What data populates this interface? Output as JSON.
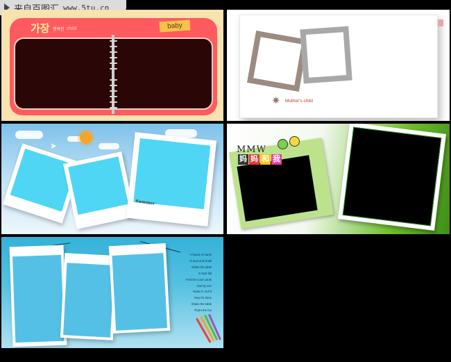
{
  "watermark": {
    "brand": "来自百图汇",
    "site": "www.5tu.cn",
    "arrow_icon": "play-triangle-icon"
  },
  "tiles": [
    {
      "id": "korean-notebook",
      "title_ko": "가장",
      "title_sub": "행복한",
      "title_en": "child",
      "tag": "baby",
      "colors": {
        "background": "#f7e2b0",
        "frame": "#ff5a5f",
        "inner": "#2a0606"
      }
    },
    {
      "id": "mothers-child",
      "brand": "Mother's child",
      "colors": {
        "frame1": "#9c8b82",
        "frame2": "#a8a8a8",
        "text": "#c0392b"
      }
    },
    {
      "id": "sky-polaroids",
      "label": "Summer",
      "colors": {
        "photo": "#4fd6f5",
        "sun": "#f7a32a"
      }
    },
    {
      "id": "green-frames",
      "title": "MMW",
      "chars": [
        "妈",
        "妈",
        "和",
        "我"
      ],
      "colors": {
        "frame": "#bde28c",
        "accent": "#6fc02e"
      }
    },
    {
      "id": "hanging-cards",
      "poem": [
        "A house of cards",
        "Is neat and small",
        "Shake the table",
        "It must fall",
        "Find the court cards",
        "One by one",
        "Raise it, roof it",
        "Now it's done",
        "Shake the table",
        "That's the fun"
      ],
      "colors": {
        "photo": "#55c0e6"
      }
    }
  ]
}
